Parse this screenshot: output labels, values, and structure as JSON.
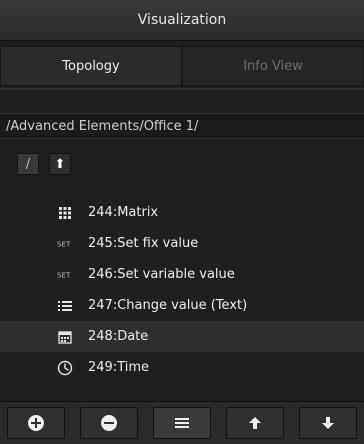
{
  "window": {
    "title": "Visualization"
  },
  "tabs": [
    {
      "label": "Topology",
      "active": true
    },
    {
      "label": "Info View",
      "active": false
    }
  ],
  "path": {
    "value": "/Advanced Elements/Office 1/"
  },
  "path_buttons": [
    {
      "label": "/"
    },
    {
      "label": "⬆"
    }
  ],
  "items": [
    {
      "label": "244:Matrix",
      "icon": "matrix-icon",
      "selected": false
    },
    {
      "label": "245:Set fix value",
      "icon": "set-icon",
      "selected": false
    },
    {
      "label": "246:Set variable value",
      "icon": "set-icon",
      "selected": false
    },
    {
      "label": "247:Change value (Text)",
      "icon": "list-icon",
      "selected": false
    },
    {
      "label": "248:Date",
      "icon": "calendar-icon",
      "selected": true
    },
    {
      "label": "249:Time",
      "icon": "clock-icon",
      "selected": false
    }
  ],
  "bottom_toolbar": [
    {
      "name": "add",
      "icon": "plus-circle-icon"
    },
    {
      "name": "remove",
      "icon": "minus-circle-icon"
    },
    {
      "name": "list",
      "icon": "list-icon"
    },
    {
      "name": "move-up",
      "icon": "arrow-up-icon"
    },
    {
      "name": "move-down",
      "icon": "arrow-down-icon"
    }
  ],
  "colors": {
    "background": "#1f1f1f",
    "header": "#2a2a2a",
    "selected_row": "#2e2e2e",
    "text": "#efefef"
  }
}
